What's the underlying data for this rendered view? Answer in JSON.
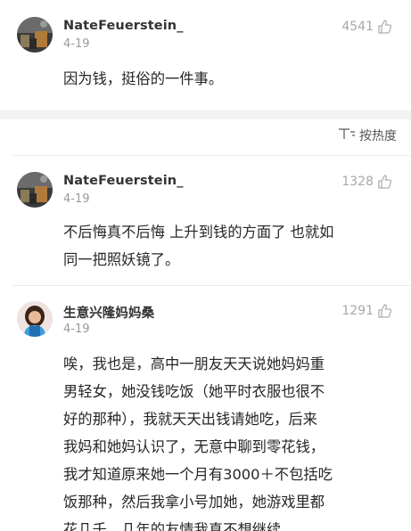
{
  "comments": [
    {
      "username": "NateFeuerstein_",
      "date": "4-19",
      "likes": "4541",
      "lines": [
        "因为钱，挺俗的一件事。"
      ]
    },
    {
      "username": "NateFeuerstein_",
      "date": "4-19",
      "likes": "1328",
      "lines": [
        "不后悔真不后悔 上升到钱的方面了 也就如",
        "同一把照妖镜了。"
      ]
    },
    {
      "username": "生意兴隆妈妈桑",
      "date": "4-19",
      "likes": "1291",
      "lines": [
        "唉，我也是，高中一朋友天天说她妈妈重",
        "男轻女，她没钱吃饭（她平时衣服也很不",
        "好的那种），我就天天出钱请她吃，后来",
        "我妈和她妈认识了，无意中聊到零花钱，",
        "我才知道原来她一个月有3000＋不包括吃",
        "饭那种，然后我拿小号加她，她游戏里都",
        "花几千，几年的友情我真不想继续"
      ]
    }
  ],
  "sort": {
    "label": "按热度",
    "icon": "sort-icon"
  },
  "icons": {
    "like": "thumbs-up-icon"
  },
  "colors": {
    "muted": "#a8a8a8",
    "text": "#262626",
    "band": "#f2f2f2"
  }
}
